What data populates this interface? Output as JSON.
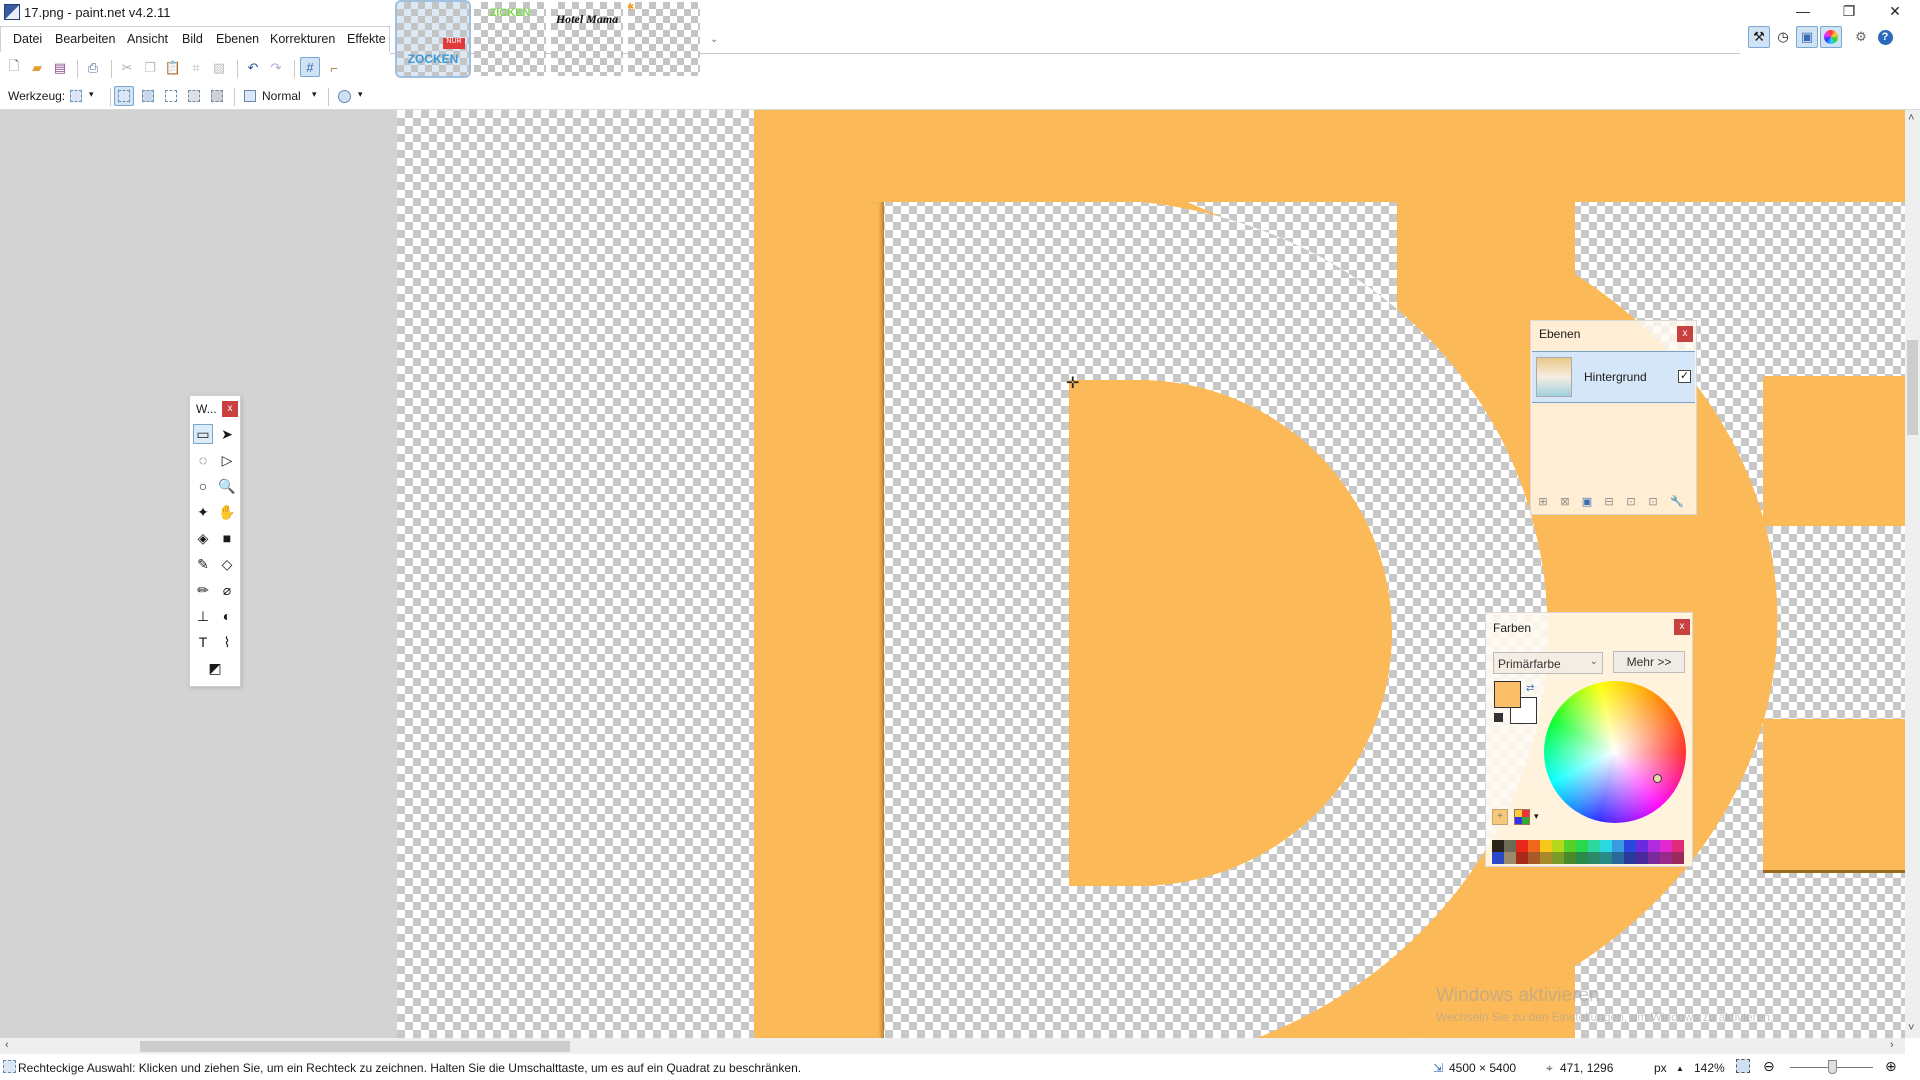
{
  "window": {
    "title": "17.png - paint.net v4.2.11",
    "minimize": "—",
    "restore": "❐",
    "close": "✕"
  },
  "menu": [
    "Datei",
    "Bearbeiten",
    "Ansicht",
    "Bild",
    "Ebenen",
    "Korrekturen",
    "Effekte"
  ],
  "image_tabs": [
    {
      "label": "ZOCKEN",
      "active": true
    },
    {
      "label": "ZICKEN",
      "active": false
    },
    {
      "label": "Hotel Mama",
      "active": false
    },
    {
      "label": "",
      "active": false,
      "unsaved": true
    }
  ],
  "toolbar": {
    "icons": [
      "new-icon",
      "open-icon",
      "save-icon",
      "print-icon",
      "cut-icon",
      "copy-icon",
      "paste-icon",
      "crop-icon",
      "deselect-icon",
      "undo-icon",
      "redo-icon",
      "grid-icon",
      "ruler-icon"
    ]
  },
  "tool_options": {
    "tool_label": "Werkzeug:",
    "blend_mode": "Normal"
  },
  "right_toolbar": [
    "tools-window-icon",
    "history-icon",
    "layers-window-icon",
    "colors-window-icon",
    "settings-icon",
    "help-icon"
  ],
  "tools_window": {
    "title": "W...",
    "close": "x",
    "tools": [
      {
        "name": "rectangle-select",
        "glyph": "▭"
      },
      {
        "name": "move-selected",
        "glyph": "➤"
      },
      {
        "name": "lasso-select",
        "glyph": "◌"
      },
      {
        "name": "move-selection",
        "glyph": "▷"
      },
      {
        "name": "ellipse-select",
        "glyph": "○"
      },
      {
        "name": "zoom",
        "glyph": "🔍"
      },
      {
        "name": "magic-wand",
        "glyph": "✦"
      },
      {
        "name": "pan",
        "glyph": "✋"
      },
      {
        "name": "paint-bucket",
        "glyph": "◈"
      },
      {
        "name": "gradient",
        "glyph": "■"
      },
      {
        "name": "paintbrush",
        "glyph": "✎"
      },
      {
        "name": "eraser",
        "glyph": "◇"
      },
      {
        "name": "pencil",
        "glyph": "✏"
      },
      {
        "name": "color-picker",
        "glyph": "⌀"
      },
      {
        "name": "clone-stamp",
        "glyph": "⊥"
      },
      {
        "name": "recolor",
        "glyph": "◐"
      },
      {
        "name": "text",
        "glyph": "T"
      },
      {
        "name": "line-curve",
        "glyph": "⌇"
      },
      {
        "name": "shapes",
        "glyph": "◩"
      }
    ]
  },
  "layers_panel": {
    "title": "Ebenen",
    "close": "x",
    "layers": [
      {
        "name": "Hintergrund",
        "visible": true,
        "selected": true
      }
    ]
  },
  "colors_panel": {
    "title": "Farben",
    "close": "x",
    "mode": "Primärfarbe",
    "more_button": "Mehr >>",
    "primary_color": "#fbbf6a",
    "secondary_color": "#ffffff",
    "palette_top": [
      "#2a2418",
      "#6e6a58",
      "#e8281c",
      "#f0661a",
      "#f6c81c",
      "#b4d81a",
      "#58d02a",
      "#2ad84c",
      "#2ad8a0",
      "#2ad8e0",
      "#3a9ae0",
      "#2a48e0",
      "#6a2ae0",
      "#b02ae0",
      "#e02ad0",
      "#e02a7a"
    ],
    "palette_bottom": [
      "#2a48c8",
      "#9a8a6a",
      "#a82a1a",
      "#a85a2a",
      "#a88a2a",
      "#7a9a2a",
      "#4a8a2a",
      "#2a8a4a",
      "#2a8a6a",
      "#2a8a8a",
      "#2a6a9a",
      "#2a3a9a",
      "#4a2a9a",
      "#7a2a9a",
      "#9a2a8a",
      "#9a2a5a"
    ]
  },
  "canvas": {
    "fill_color": "#fbb957"
  },
  "watermark": {
    "title": "Windows aktivieren",
    "subtitle": "Wechseln Sie zu den Einstellungen, um Windows zu aktivieren."
  },
  "statusbar": {
    "hint": "Rechteckige Auswahl: Klicken und ziehen Sie, um ein Rechteck zu zeichnen. Halten Sie die Umschalttaste, um es auf ein Quadrat zu beschränken.",
    "image_size": "4500 × 5400",
    "cursor_pos": "471, 1296",
    "units": "px",
    "zoom": "142%"
  }
}
